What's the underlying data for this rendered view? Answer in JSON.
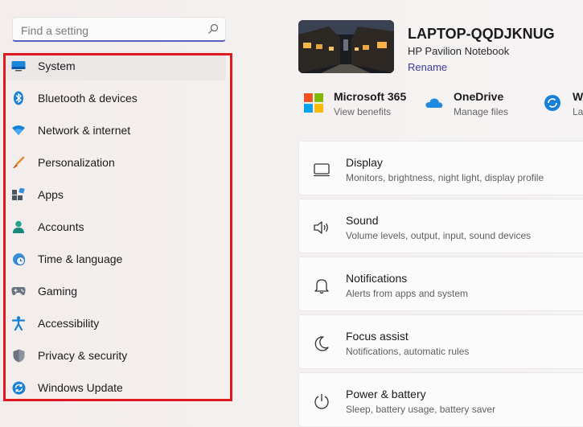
{
  "search": {
    "placeholder": "Find a setting"
  },
  "sidebar": {
    "items": [
      {
        "label": "System",
        "icon": "system-icon",
        "active": true
      },
      {
        "label": "Bluetooth & devices",
        "icon": "bluetooth-icon"
      },
      {
        "label": "Network & internet",
        "icon": "wifi-icon"
      },
      {
        "label": "Personalization",
        "icon": "brush-icon"
      },
      {
        "label": "Apps",
        "icon": "apps-icon"
      },
      {
        "label": "Accounts",
        "icon": "person-icon"
      },
      {
        "label": "Time & language",
        "icon": "clock-globe-icon"
      },
      {
        "label": "Gaming",
        "icon": "gamepad-icon"
      },
      {
        "label": "Accessibility",
        "icon": "accessibility-icon"
      },
      {
        "label": "Privacy & security",
        "icon": "shield-icon"
      },
      {
        "label": "Windows Update",
        "icon": "update-icon"
      }
    ]
  },
  "device": {
    "name": "LAPTOP-QQDJKNUG",
    "model": "HP Pavilion Notebook",
    "rename_label": "Rename"
  },
  "apps": [
    {
      "title": "Microsoft 365",
      "subtitle": "View benefits",
      "icon": "microsoft-logo-icon"
    },
    {
      "title": "OneDrive",
      "subtitle": "Manage files",
      "icon": "onedrive-icon"
    },
    {
      "title": "W",
      "subtitle": "La",
      "icon": "sync-icon"
    }
  ],
  "cards": [
    {
      "title": "Display",
      "subtitle": "Monitors, brightness, night light, display profile",
      "icon": "monitor-icon"
    },
    {
      "title": "Sound",
      "subtitle": "Volume levels, output, input, sound devices",
      "icon": "speaker-icon"
    },
    {
      "title": "Notifications",
      "subtitle": "Alerts from apps and system",
      "icon": "bell-icon"
    },
    {
      "title": "Focus assist",
      "subtitle": "Notifications, automatic rules",
      "icon": "moon-icon"
    },
    {
      "title": "Power & battery",
      "subtitle": "Sleep, battery usage, battery saver",
      "icon": "power-icon"
    }
  ],
  "colors": {
    "accent": "#5b5fc7",
    "highlight_border": "#e0181f",
    "link": "#3b3b9e"
  }
}
